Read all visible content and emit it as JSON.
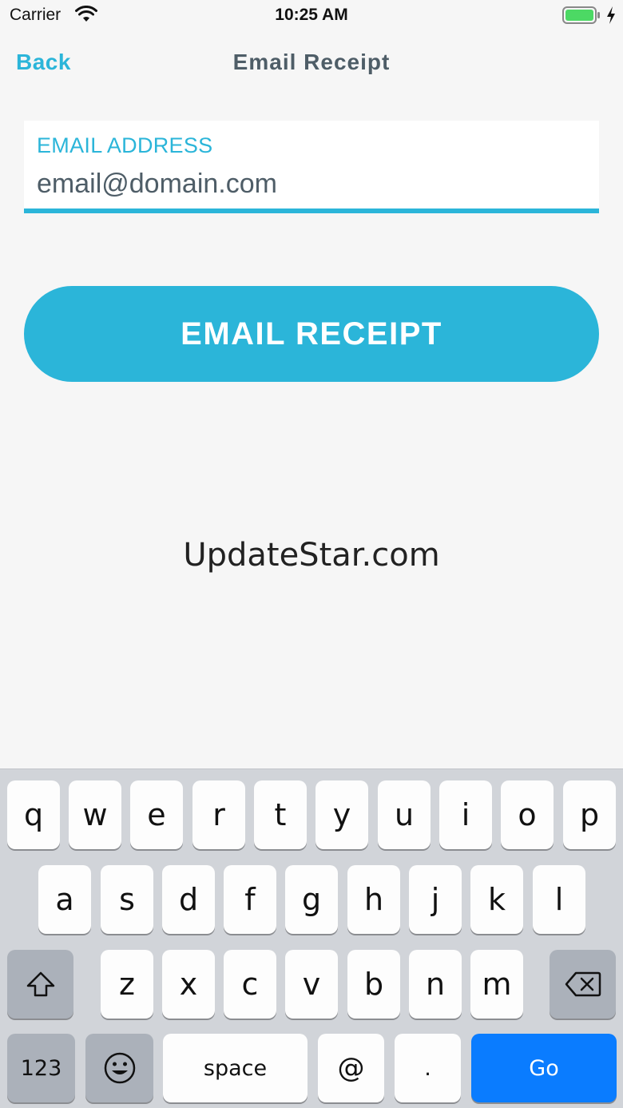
{
  "status_bar": {
    "carrier": "Carrier",
    "time": "10:25 AM",
    "wifi_icon": "wifi-icon",
    "battery_icon": "battery-icon",
    "battery_color": "#4cd964"
  },
  "nav": {
    "back_label": "Back",
    "title": "Email Receipt"
  },
  "email_field": {
    "label": "EMAIL ADDRESS",
    "placeholder": "email@domain.com",
    "value": ""
  },
  "send_button": {
    "label": "EMAIL RECEIPT"
  },
  "watermark": "UpdateStar.com",
  "colors": {
    "accent": "#2bb5d9",
    "text_dark": "#4e5d67",
    "background": "#f6f6f6",
    "go_key": "#0a7cff"
  },
  "keyboard": {
    "row1": [
      "q",
      "w",
      "e",
      "r",
      "t",
      "y",
      "u",
      "i",
      "o",
      "p"
    ],
    "row2": [
      "a",
      "s",
      "d",
      "f",
      "g",
      "h",
      "j",
      "k",
      "l"
    ],
    "row3": [
      "z",
      "x",
      "c",
      "v",
      "b",
      "n",
      "m"
    ],
    "shift_icon": "shift-icon",
    "delete_icon": "backspace-icon",
    "numbers_label": "123",
    "emoji_icon": "emoji-icon",
    "space_label": "space",
    "at_label": "@",
    "dot_label": ".",
    "go_label": "Go"
  }
}
